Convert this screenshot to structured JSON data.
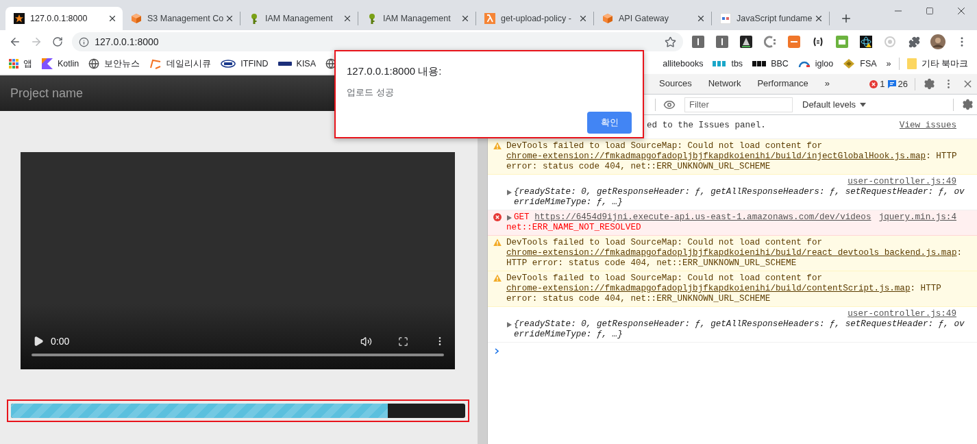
{
  "browser": {
    "tabs": [
      {
        "title": "127.0.0.1:8000",
        "kind": "star",
        "selected": true
      },
      {
        "title": "S3 Management Co",
        "kind": "cube",
        "selected": false
      },
      {
        "title": "IAM Management",
        "kind": "key",
        "selected": false
      },
      {
        "title": "IAM Management",
        "kind": "key",
        "selected": false
      },
      {
        "title": "get-upload-policy -",
        "kind": "lambda",
        "selected": false
      },
      {
        "title": "API Gateway",
        "kind": "cube",
        "selected": false
      },
      {
        "title": "JavaScript fundame",
        "kind": "w3r",
        "selected": false
      }
    ],
    "address": "127.0.0.1:8000",
    "bookmarks_left": [
      {
        "label": "앱",
        "kind": "apps"
      },
      {
        "label": "Kotlin",
        "kind": "kotlin"
      },
      {
        "label": "보안뉴스",
        "kind": "globe"
      },
      {
        "label": "데일리시큐",
        "kind": "bracket"
      },
      {
        "label": "ITFIND",
        "kind": "itfind"
      },
      {
        "label": "KISA",
        "kind": "kisa"
      },
      {
        "kind": "globe"
      }
    ],
    "bookmarks_right": [
      {
        "label": "allitebooks",
        "kind": "none"
      },
      {
        "label": "tbs",
        "kind": "tbs"
      },
      {
        "label": "BBC",
        "kind": "bbc"
      },
      {
        "label": "igloo",
        "kind": "igloo"
      },
      {
        "label": "FSA",
        "kind": "fsa"
      }
    ],
    "more": "»",
    "other_bookmarks": "기타 북마크"
  },
  "page": {
    "brand": "Project name",
    "video": {
      "time": "0:00"
    },
    "upload_progress": {
      "level": 0.83
    }
  },
  "devtools": {
    "tabs": [
      {
        "label": "Sources",
        "selected": false
      },
      {
        "label": "Network",
        "selected": false
      },
      {
        "label": "Performance",
        "selected": false
      }
    ],
    "more": "»",
    "error_count": "1",
    "message_count": "26",
    "filter": {
      "placeholder": "Filter"
    },
    "levels": "Default levels",
    "messages": [
      {
        "kind": "info",
        "text": "ed to the Issues panel.",
        "link": "View issues"
      },
      {
        "kind": "warning",
        "before": "DevTools failed to load SourceMap: Could not load content for ",
        "link": "chrome-extension://fmkadmapgofadopljbjfkapdkoienihi/build/injectGlobalHook.js.map",
        "after": ": HTTP error: status code 404, net::ERR_UNKNOWN_URL_SCHEME"
      },
      {
        "kind": "log",
        "source": "user-controller.js:49",
        "text": "{readyState: 0, getResponseHeader: ƒ, getAllResponseHeaders: ƒ, setRequestHeader: ƒ, overrideMimeType: ƒ, …}"
      },
      {
        "kind": "error",
        "method": "GET",
        "link": "https://6454d9ijni.execute-api.us-east-1.amazonaws.com/dev/videos",
        "source": "jquery.min.js:4",
        "detail": "net::ERR_NAME_NOT_RESOLVED"
      },
      {
        "kind": "warning",
        "before": "DevTools failed to load SourceMap: Could not load content for ",
        "link": "chrome-extension://fmkadmapgofadopljbjfkapdkoienihi/build/react_devtools_backend.js.map",
        "after": ": HTTP error: status code 404, net::ERR_UNKNOWN_URL_SCHEME"
      },
      {
        "kind": "warning",
        "before": "DevTools failed to load SourceMap: Could not load content for ",
        "link": "chrome-extension://fmkadmapgofadopljbjfkapdkoienihi/build/contentScript.js.map",
        "after": ": HTTP error: status code 404, net::ERR_UNKNOWN_URL_SCHEME"
      },
      {
        "kind": "log",
        "source": "user-controller.js:49",
        "text": "{readyState: 0, getResponseHeader: ƒ, getAllResponseHeaders: ƒ, setRequestHeader: ƒ, overrideMimeType: ƒ, …}"
      }
    ]
  },
  "dialog": {
    "title": "127.0.0.1:8000 내용:",
    "message": "업로드 성공",
    "button": "확인"
  }
}
